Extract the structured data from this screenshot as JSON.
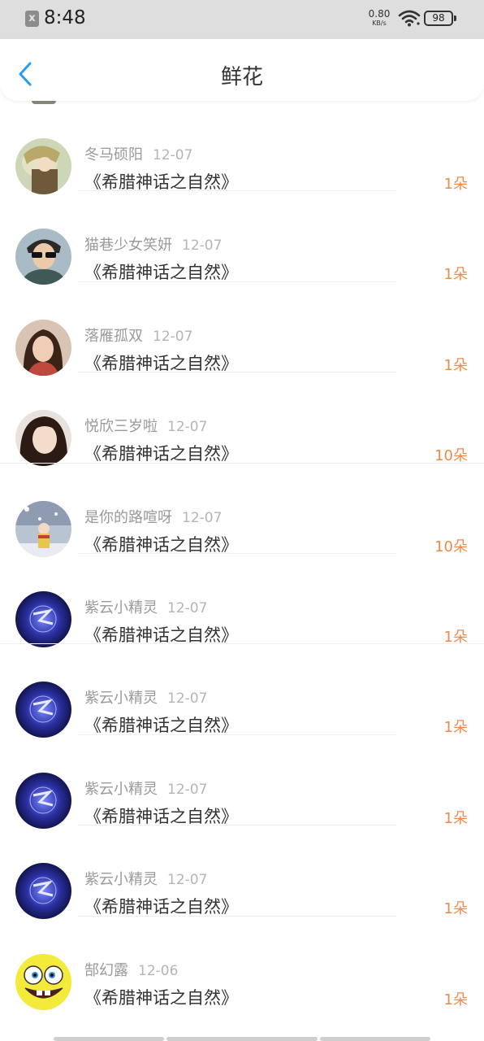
{
  "status_bar": {
    "notification_glyph": "x",
    "time": "8:48",
    "net_speed_value": "0.80",
    "net_speed_unit": "KB/s",
    "battery": "98",
    "icons": [
      "notification-x-icon",
      "wifi-icon",
      "battery-icon"
    ]
  },
  "header": {
    "title": "鲜花",
    "back_icon": "chevron-left-icon",
    "accent_color": "#2b9af3"
  },
  "colors": {
    "count_color": "#f08a4b",
    "name_color": "#9a9a9a",
    "title_color": "#333333"
  },
  "gifts": [
    {
      "user": "冬马硕阳",
      "date": "12-07",
      "book": "《希腊神话之自然》",
      "count": "1朵",
      "avatar": "anime-character-avatar"
    },
    {
      "user": "猫巷少女笑妍",
      "date": "12-07",
      "book": "《希腊神话之自然》",
      "count": "1朵",
      "avatar": "man-sunglasses-avatar"
    },
    {
      "user": "落雁孤双",
      "date": "12-07",
      "book": "《希腊神话之自然》",
      "count": "1朵",
      "avatar": "woman-photo-avatar"
    },
    {
      "user": "悦欣三岁啦",
      "date": "12-07",
      "book": "《希腊神话之自然》",
      "count": "10朵",
      "avatar": "girl-photo-avatar"
    },
    {
      "user": "是你的路喧呀",
      "date": "12-07",
      "book": "《希腊神话之自然》",
      "count": "10朵",
      "avatar": "snow-scene-avatar"
    },
    {
      "user": "紫云小精灵",
      "date": "12-07",
      "book": "《希腊神话之自然》",
      "count": "1朵",
      "avatar": "purple-galaxy-avatar"
    },
    {
      "user": "紫云小精灵",
      "date": "12-07",
      "book": "《希腊神话之自然》",
      "count": "1朵",
      "avatar": "purple-galaxy-avatar"
    },
    {
      "user": "紫云小精灵",
      "date": "12-07",
      "book": "《希腊神话之自然》",
      "count": "1朵",
      "avatar": "purple-galaxy-avatar"
    },
    {
      "user": "紫云小精灵",
      "date": "12-07",
      "book": "《希腊神话之自然》",
      "count": "1朵",
      "avatar": "purple-galaxy-avatar"
    },
    {
      "user": "郜幻露",
      "date": "12-06",
      "book": "《希腊神话之自然》",
      "count": "1朵",
      "avatar": "spongebob-avatar"
    }
  ]
}
